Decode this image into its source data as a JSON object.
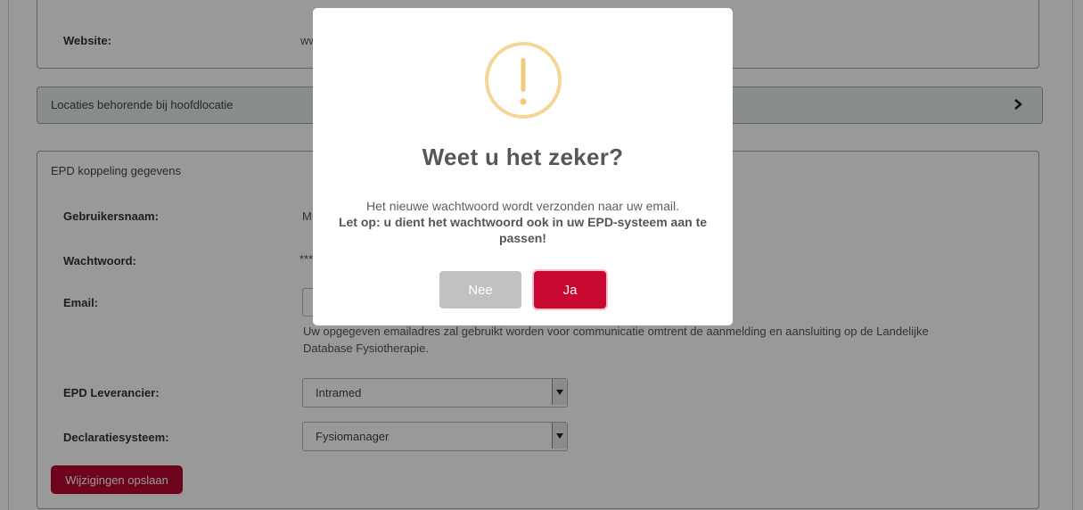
{
  "background": {
    "website_label": "Website:",
    "website_value_partial": "ww",
    "locaties_heading": "Locaties behorende bij hoofdlocatie",
    "epd_heading": "EPD koppeling gegevens",
    "gebruikersnaam_label": "Gebruikersnaam:",
    "gebruikersnaam_value_partial": "M",
    "wachtwoord_label": "Wachtwoord:",
    "wachtwoord_value_partial": "***",
    "email_label": "Email:",
    "email_help": "Uw opgegeven emailadres zal gebruikt worden voor communicatie omtrent de aanmelding en aansluiting op de Landelijke Database Fysiotherapie.",
    "epd_leverancier_label": "EPD Leverancier:",
    "epd_leverancier_value": "Intramed",
    "declaratiesysteem_label": "Declaratiesysteem:",
    "declaratiesysteem_value": "Fysiomanager",
    "save_label": "Wijzigingen opslaan"
  },
  "dialog": {
    "icon": "warning-icon",
    "title": "Weet u het zeker?",
    "message_line": "Het nieuwe wachtwoord wordt verzonden naar uw email.",
    "message_bold": "Let op: u dient het wachtwoord ook in uw EPD-systeem aan te passen!",
    "cancel_label": "Nee",
    "confirm_label": "Ja"
  },
  "colors": {
    "brand_red": "#c9082f",
    "save_red": "#b8072f",
    "cancel_grey": "#c1c1c1",
    "warning_ring": "#f5d699"
  }
}
